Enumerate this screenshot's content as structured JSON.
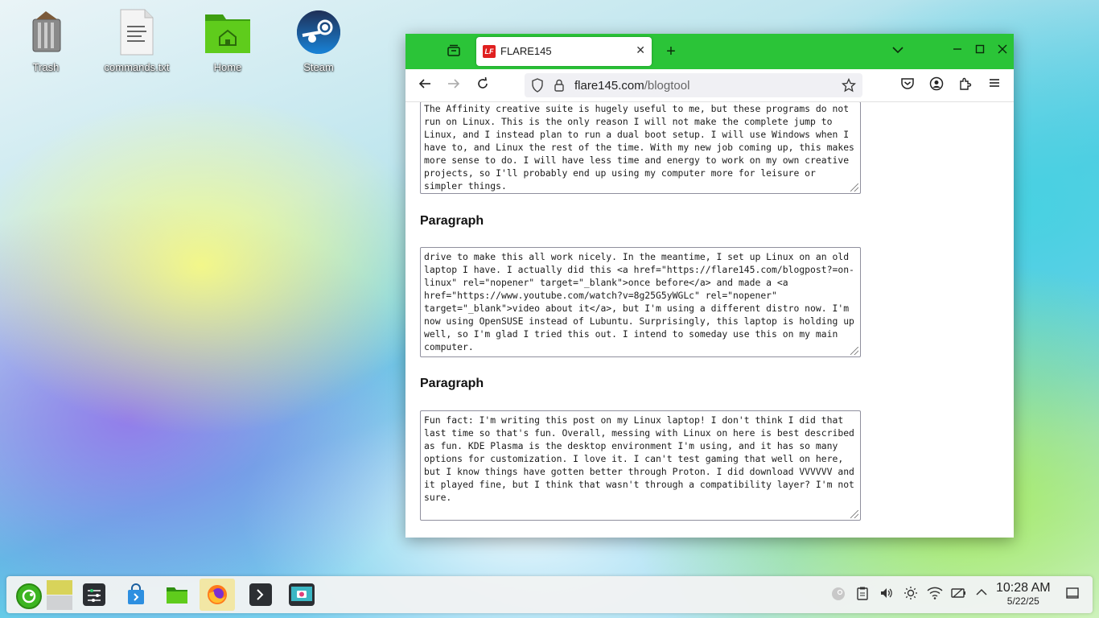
{
  "desktop": {
    "icons": [
      {
        "label": "Trash"
      },
      {
        "label": "commands.txt"
      },
      {
        "label": "Home"
      },
      {
        "label": "Steam"
      }
    ]
  },
  "browser": {
    "tab_title": "FLARE145",
    "url_host": "flare145.com",
    "url_path": "/blogtool",
    "textareas": [
      "The Affinity creative suite is hugely useful to me, but these programs do not run on Linux. This is the only reason I will not make the complete jump to Linux, and I instead plan to run a dual boot setup. I will use Windows when I have to, and Linux the rest of the time. With my new job coming up, this makes more sense to do. I will have less time and energy to work on my own creative projects, so I'll probably end up using my computer more for leisure or simpler things.",
      "drive to make this all work nicely. In the meantime, I set up Linux on an old laptop I have. I actually did this <a href=\"https://flare145.com/blogpost?=on-linux\" rel=\"nopener\" target=\"_blank\">once before</a> and made a <a href=\"https://www.youtube.com/watch?v=8g25G5yWGLc\" rel=\"nopener\" target=\"_blank\">video about it</a>, but I'm using a different distro now. I'm now using OpenSUSE instead of Lubuntu. Surprisingly, this laptop is holding up well, so I'm glad I tried this out. I intend to someday use this on my main computer.",
      "Fun fact: I'm writing this post on my Linux laptop! I don't think I did that last time so that's fun. Overall, messing with Linux on here is best described as fun. KDE Plasma is the desktop environment I'm using, and it has so many options for customization. I love it. I can't test gaming that well on here, but I know things have gotten better through Proton. I did download VVVVVV and it played fine, but I think that wasn't through a compatibility layer? I'm not sure."
    ],
    "paragraph_headings": [
      "Paragraph",
      "Paragraph"
    ]
  },
  "taskbar": {
    "time": "10:28 AM",
    "date": "5/22/25"
  },
  "colors": {
    "tabbar_green": "#2bc438",
    "favicon_red": "#e02020"
  }
}
